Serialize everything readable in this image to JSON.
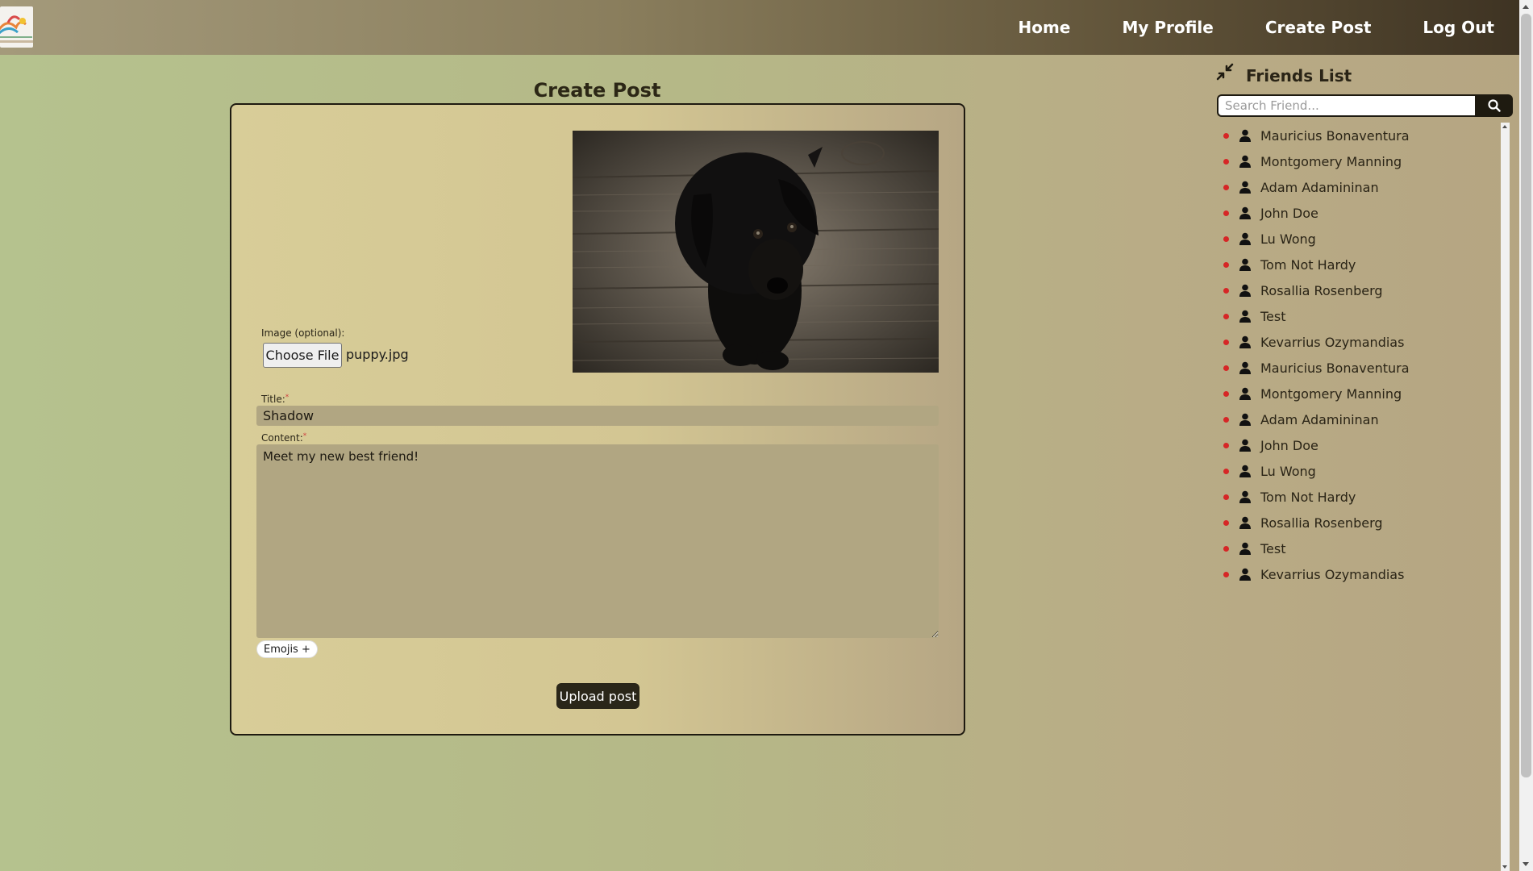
{
  "nav": {
    "links": [
      {
        "label": "Home"
      },
      {
        "label": "My Profile"
      },
      {
        "label": "Create Post"
      },
      {
        "label": "Log Out"
      }
    ],
    "logo_icon": "friendfeed-logo"
  },
  "page": {
    "title": "Create Post"
  },
  "form": {
    "image_label": "Image (optional):",
    "choose_file_label": "Choose File",
    "file_name": "puppy.jpg",
    "preview_icon": "black-puppy-photo",
    "title_label": "Title:",
    "title_value": "Shadow",
    "content_label": "Content:",
    "content_value": "Meet my new best friend!",
    "required_mark": "*",
    "emojis_label": "Emojis +",
    "upload_label": "Upload post"
  },
  "friends": {
    "title": "Friends List",
    "search_placeholder": "Search Friend...",
    "collapse_icon": "compress-icon",
    "search_icon": "search-icon",
    "status_color": "#d62626",
    "items": [
      {
        "name": "Mauricius Bonaventura"
      },
      {
        "name": "Montgomery Manning"
      },
      {
        "name": "Adam Adamininan"
      },
      {
        "name": "John Doe"
      },
      {
        "name": "Lu Wong"
      },
      {
        "name": "Tom Not Hardy"
      },
      {
        "name": "Rosallia Rosenberg"
      },
      {
        "name": "Test"
      },
      {
        "name": "Kevarrius Ozymandias"
      },
      {
        "name": "Mauricius Bonaventura"
      },
      {
        "name": "Montgomery Manning"
      },
      {
        "name": "Adam Adamininan"
      },
      {
        "name": "John Doe"
      },
      {
        "name": "Lu Wong"
      },
      {
        "name": "Tom Not Hardy"
      },
      {
        "name": "Rosallia Rosenberg"
      },
      {
        "name": "Test"
      },
      {
        "name": "Kevarrius Ozymandias"
      }
    ]
  }
}
